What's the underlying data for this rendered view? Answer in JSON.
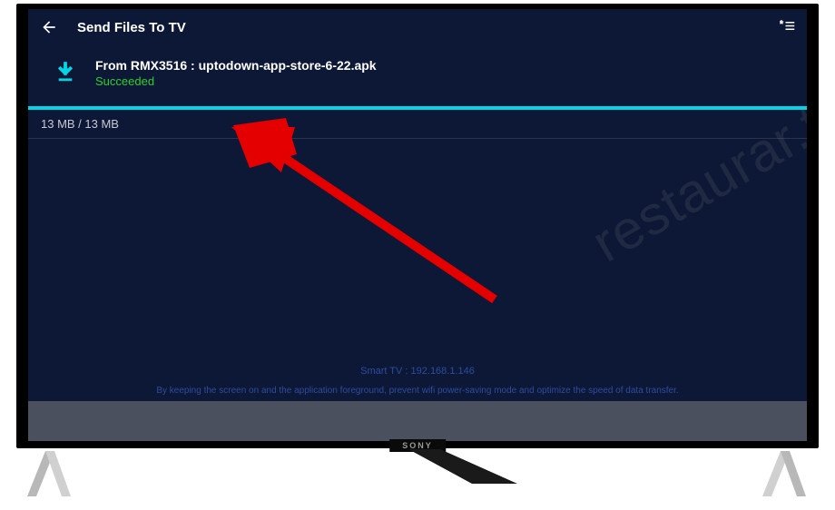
{
  "header": {
    "title": "Send Files To TV"
  },
  "transfer": {
    "from_label": "From RMX3516 : uptodown-app-store-6-22.apk",
    "status": "Succeeded",
    "size_text": "13 MB / 13 MB"
  },
  "footer": {
    "ip_line": "Smart TV : 192.168.1.146",
    "tip": "By keeping the screen on and the application foreground, prevent wifi power-saving mode and optimize the speed of data transfer."
  },
  "tv": {
    "brand": "SONY"
  },
  "watermark": "restaurar.tv"
}
